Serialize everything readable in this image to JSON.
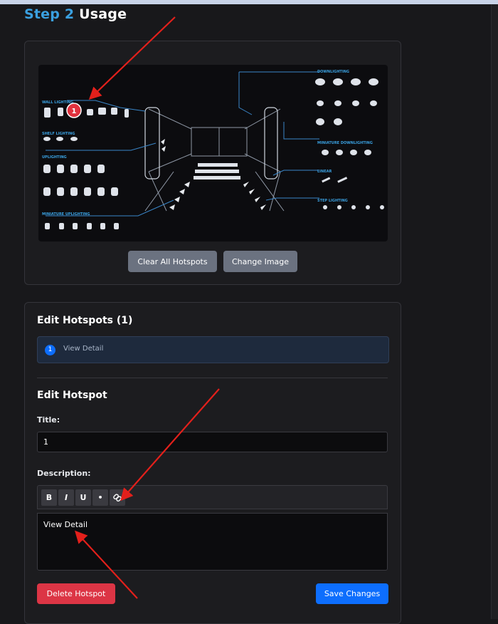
{
  "step": {
    "number": "Step 2",
    "title": "Usage"
  },
  "image": {
    "marker_label": "1",
    "sections": {
      "wall": "WALL LIGHTING",
      "shelf": "SHELF LIGHTING",
      "uplighting": "UPLIGHTING",
      "miniature_uplighting": "MINIATURE UPLIGHTING",
      "downlighting": "DOWNLIGHTING",
      "miniature_downlighting": "MINIATURE DOWNLIGHTING",
      "linear": "LINEAR",
      "step": "STEP LIGHTING"
    }
  },
  "buttons": {
    "clear_all": "Clear All Hotspots",
    "change_image": "Change Image",
    "delete": "Delete Hotspot",
    "save": "Save Changes"
  },
  "hotspots": {
    "heading": "Edit Hotspots (1)",
    "items": [
      {
        "badge": "1",
        "label": "View Detail"
      }
    ]
  },
  "edit": {
    "heading": "Edit Hotspot",
    "title_label": "Title:",
    "title_value": "1",
    "description_label": "Description:",
    "description_value": "View Detail",
    "toolbar": {
      "bold": "B",
      "italic": "I",
      "underline": "U",
      "bullet": "•"
    }
  },
  "colors": {
    "accent": "#3aa0e0",
    "primary": "#0d6efd",
    "danger": "#dc3545",
    "annotation": "#e3201b"
  }
}
